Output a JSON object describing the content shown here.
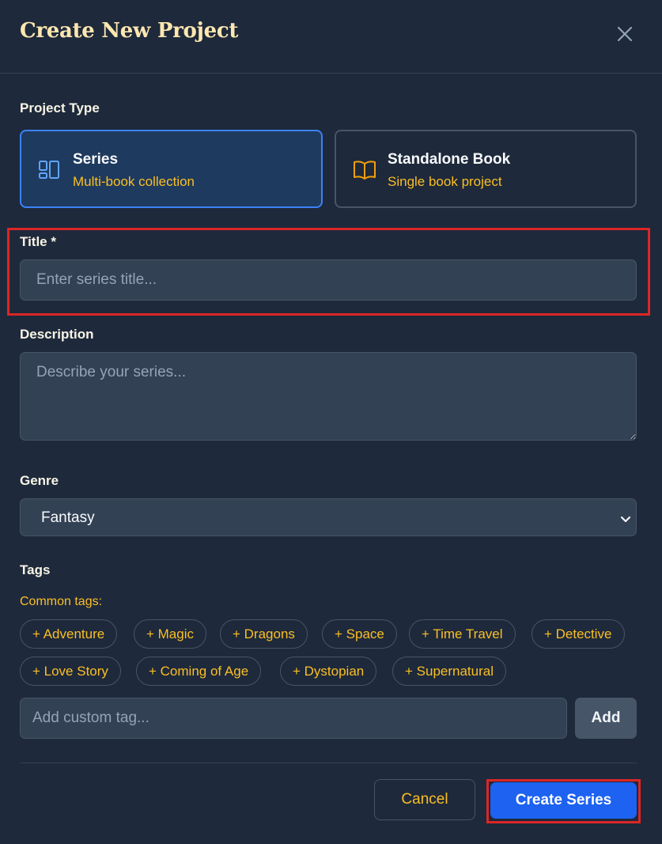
{
  "header": {
    "title": "Create New Project",
    "close_icon": "close-icon"
  },
  "project_type": {
    "label": "Project Type",
    "options": [
      {
        "title": "Series",
        "subtitle": "Multi-book collection",
        "icon": "layout-grid-icon",
        "selected": true
      },
      {
        "title": "Standalone Book",
        "subtitle": "Single book project",
        "icon": "book-open-icon",
        "selected": false
      }
    ]
  },
  "title_field": {
    "label": "Title *",
    "placeholder": "Enter series title...",
    "value": ""
  },
  "description_field": {
    "label": "Description",
    "placeholder": "Describe your series...",
    "value": ""
  },
  "genre_field": {
    "label": "Genre",
    "selected": "Fantasy"
  },
  "tags": {
    "label": "Tags",
    "common_label": "Common tags:",
    "common": [
      "+ Adventure",
      "+ Magic",
      "+ Dragons",
      "+ Space",
      "+ Time Travel",
      "+ Detective",
      "+ Love Story",
      "+ Coming of Age",
      "+ Dystopian",
      "+ Supernatural"
    ],
    "custom_placeholder": "Add custom tag...",
    "add_label": "Add"
  },
  "footer": {
    "cancel_label": "Cancel",
    "submit_label": "Create Series"
  },
  "colors": {
    "background": "#1e293b",
    "accent_blue": "#3b82f6",
    "accent_amber": "#fbbf24",
    "highlight_red": "#dc2626",
    "primary_button": "#1d62f0"
  }
}
